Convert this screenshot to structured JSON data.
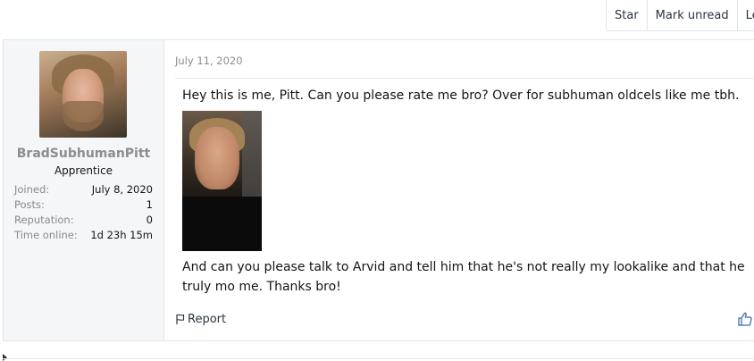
{
  "toolbar": {
    "star_label": "Star",
    "mark_unread_label": "Mark unread",
    "leave_label": "Lea"
  },
  "user": {
    "name": "BradSubhumanPitt",
    "title": "Apprentice",
    "stats": [
      {
        "key": "Joined:",
        "value": "July 8, 2020"
      },
      {
        "key": "Posts:",
        "value": "1"
      },
      {
        "key": "Reputation:",
        "value": "0"
      },
      {
        "key": "Time online:",
        "value": "1d 23h 15m"
      }
    ]
  },
  "post": {
    "date": "July 11, 2020",
    "text1": "Hey this is me, Pitt. Can you please rate me bro? Over for subhuman oldcels like me tbh.",
    "text2": "And can you please talk to Arvid and tell him that he's not really my lookalike and that he truly mo me. Thanks bro!",
    "report_label": "Report"
  },
  "icons": {
    "report": "flag-icon",
    "like": "thumbs-up-icon"
  }
}
